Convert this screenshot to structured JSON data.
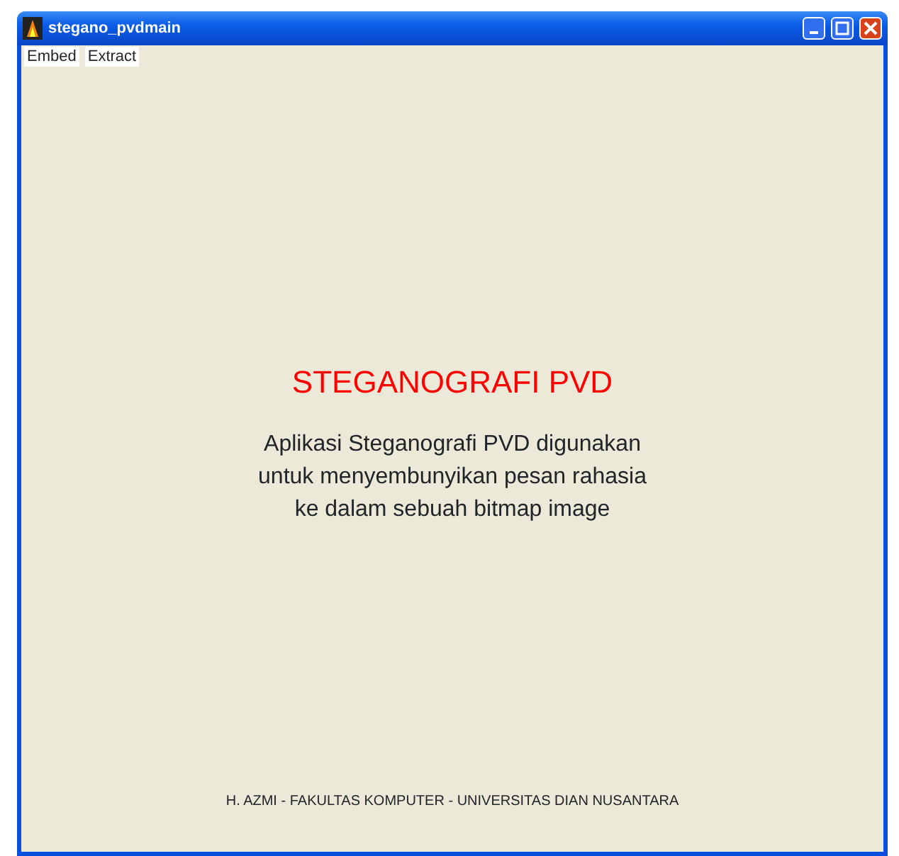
{
  "window": {
    "title": "stegano_pvdmain"
  },
  "menu": [
    {
      "label": "Embed"
    },
    {
      "label": "Extract"
    }
  ],
  "heading": "STEGANOGRAFI PVD",
  "description": [
    "Aplikasi Steganografi PVD digunakan",
    "untuk menyembunyikan pesan rahasia",
    "ke dalam sebuah bitmap image"
  ],
  "footer": "H. AZMI - FAKULTAS KOMPUTER - UNIVERSITAS DIAN NUSANTARA"
}
